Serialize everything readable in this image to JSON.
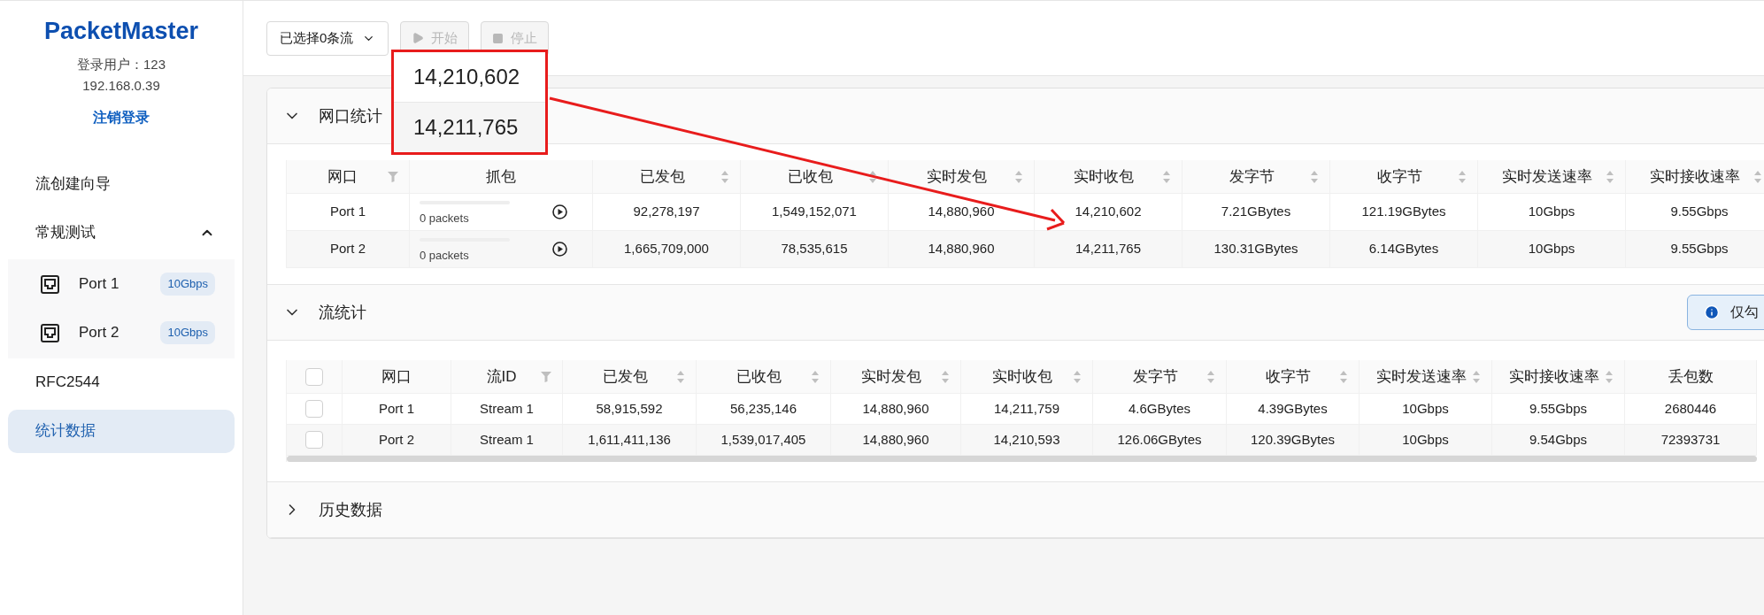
{
  "sidebar": {
    "brand": "PacketMaster",
    "user_line": "登录用户：123",
    "ip": "192.168.0.39",
    "logout": "注销登录",
    "items": [
      {
        "label": "流创建向导",
        "kind": "link",
        "selected": false
      },
      {
        "label": "常规测试",
        "kind": "group",
        "expanded": true,
        "selected": false,
        "children": [
          {
            "label": "Port 1",
            "badge": "10Gbps",
            "selected": false
          },
          {
            "label": "Port 2",
            "badge": "10Gbps",
            "selected": false
          }
        ]
      },
      {
        "label": "RFC2544",
        "kind": "link",
        "selected": false
      },
      {
        "label": "统计数据",
        "kind": "link",
        "selected": true
      }
    ]
  },
  "toolbar": {
    "stream_select": "已选择0条流",
    "buttons": [
      {
        "label": "开始",
        "kind": "start",
        "disabled": true
      },
      {
        "label": "停止",
        "kind": "stop",
        "disabled": true
      }
    ]
  },
  "callout": {
    "values": [
      "14,210,602",
      "14,211,765"
    ]
  },
  "port_stats": {
    "title": "网口统计",
    "expanded": true,
    "columns": [
      {
        "label": "网口",
        "kind": "filter"
      },
      {
        "label": "抓包",
        "kind": "plain"
      },
      {
        "label": "已发包",
        "kind": "sort"
      },
      {
        "label": "已收包",
        "kind": "sort"
      },
      {
        "label": "实时发包",
        "kind": "sort"
      },
      {
        "label": "实时收包",
        "kind": "sort"
      },
      {
        "label": "发字节",
        "kind": "sort"
      },
      {
        "label": "收字节",
        "kind": "sort"
      },
      {
        "label": "实时发送速率",
        "kind": "sort"
      },
      {
        "label": "实时接收速率",
        "kind": "sort"
      }
    ],
    "rows": [
      {
        "cells": [
          "Port 1",
          {
            "level": 0,
            "text": "0 packets"
          },
          "92,278,197",
          "1,549,152,071",
          "14,880,960",
          "14,210,602",
          "7.21GBytes",
          "121.19GBytes",
          "10Gbps",
          "9.55Gbps"
        ]
      },
      {
        "cells": [
          "Port 2",
          {
            "level": 0,
            "text": "0 packets"
          },
          "1,665,709,000",
          "78,535,615",
          "14,880,960",
          "14,211,765",
          "130.31GBytes",
          "6.14GBytes",
          "10Gbps",
          "9.55Gbps"
        ]
      }
    ]
  },
  "stream_stats": {
    "title": "流统计",
    "expanded": true,
    "info_button": "仅勾",
    "header_checked": false,
    "columns": [
      {
        "label": "网口",
        "kind": "plain"
      },
      {
        "label": "流ID",
        "kind": "filter"
      },
      {
        "label": "已发包",
        "kind": "sort"
      },
      {
        "label": "已收包",
        "kind": "sort"
      },
      {
        "label": "实时发包",
        "kind": "sort"
      },
      {
        "label": "实时收包",
        "kind": "sort"
      },
      {
        "label": "发字节",
        "kind": "sort"
      },
      {
        "label": "收字节",
        "kind": "sort"
      },
      {
        "label": "实时发送速率",
        "kind": "sort"
      },
      {
        "label": "实时接收速率",
        "kind": "sort"
      },
      {
        "label": "丢包数",
        "kind": "plain"
      }
    ],
    "rows": [
      {
        "checked": false,
        "cells": [
          "Port 1",
          "Stream 1",
          "58,915,592",
          "56,235,146",
          "14,880,960",
          "14,211,759",
          "4.6GBytes",
          "4.39GBytes",
          "10Gbps",
          "9.55Gbps",
          "2680446"
        ]
      },
      {
        "checked": false,
        "cells": [
          "Port 2",
          "Stream 1",
          "1,611,411,136",
          "1,539,017,405",
          "14,880,960",
          "14,210,593",
          "126.06GBytes",
          "120.39GBytes",
          "10Gbps",
          "9.54Gbps",
          "72393731"
        ]
      }
    ]
  },
  "history": {
    "title": "历史数据",
    "expanded": false
  }
}
